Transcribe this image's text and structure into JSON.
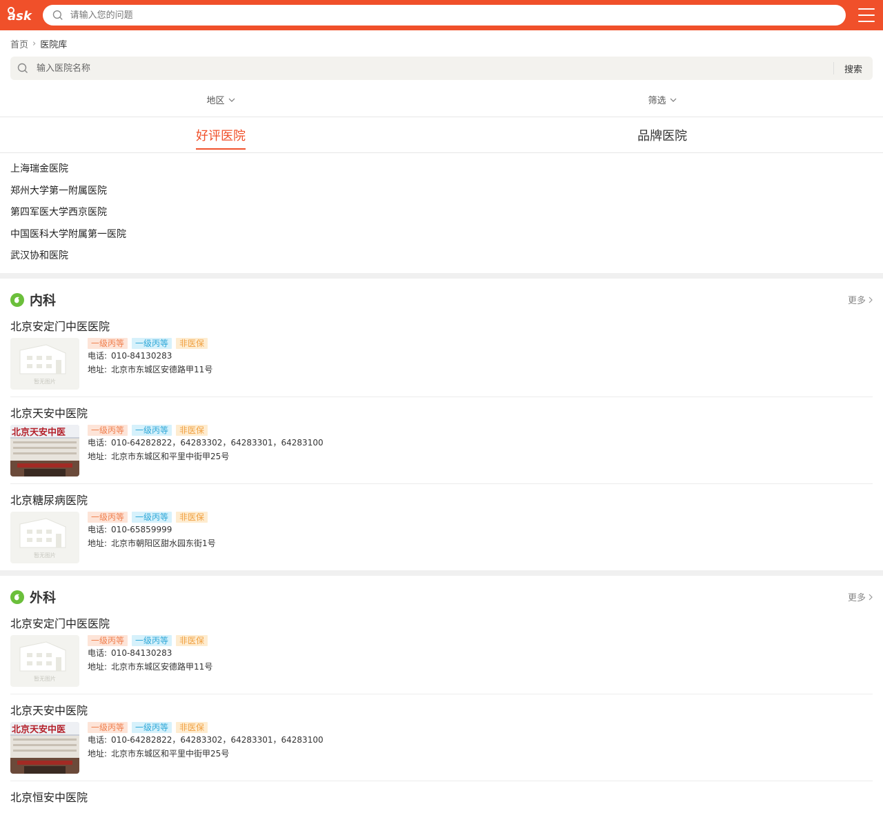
{
  "header": {
    "search_placeholder": "请输入您的问题"
  },
  "breadcrumb": {
    "home": "首页",
    "current": "医院库"
  },
  "hospital_search": {
    "placeholder": "输入医院名称",
    "button": "搜索"
  },
  "filters": [
    {
      "label": "地区"
    },
    {
      "label": "筛选"
    }
  ],
  "tabs": [
    {
      "label": "好评医院",
      "active": true
    },
    {
      "label": "品牌医院",
      "active": false
    }
  ],
  "ranking": [
    "上海瑞金医院",
    "郑州大学第一附属医院",
    "第四军医大学西京医院",
    "中国医科大学附属第一医院",
    "武汉协和医院"
  ],
  "labels": {
    "phone": "电话:",
    "address": "地址:",
    "more": "更多",
    "no_image": "暂无图片"
  },
  "sections": [
    {
      "title": "内科",
      "hospitals": [
        {
          "name": "北京安定门中医医院",
          "tags": [
            "一级丙等",
            "一级丙等",
            "非医保"
          ],
          "phone": "010-84130283",
          "address": "北京市东城区安德路甲11号",
          "image": "placeholder"
        },
        {
          "name": "北京天安中医院",
          "tags": [
            "一级丙等",
            "一级丙等",
            "非医保"
          ],
          "phone": "010-64282822，64283302，64283301，64283100",
          "address": "北京市东城区和平里中街甲25号",
          "image": "photo"
        },
        {
          "name": "北京糖尿病医院",
          "tags": [
            "一级丙等",
            "一级丙等",
            "非医保"
          ],
          "phone": "010-65859999",
          "address": "北京市朝阳区甜水园东街1号",
          "image": "placeholder"
        }
      ]
    },
    {
      "title": "外科",
      "hospitals": [
        {
          "name": "北京安定门中医医院",
          "tags": [
            "一级丙等",
            "一级丙等",
            "非医保"
          ],
          "phone": "010-84130283",
          "address": "北京市东城区安德路甲11号",
          "image": "placeholder"
        },
        {
          "name": "北京天安中医院",
          "tags": [
            "一级丙等",
            "一级丙等",
            "非医保"
          ],
          "phone": "010-64282822，64283302，64283301，64283100",
          "address": "北京市东城区和平里中街甲25号",
          "image": "photo"
        },
        {
          "name": "北京恒安中医院",
          "tags": [],
          "phone": "",
          "address": "",
          "image": ""
        }
      ]
    }
  ],
  "colors": {
    "brand": "#f0502a",
    "section_icon": "#6bbf3b"
  },
  "photo_sign": "北京天安中医"
}
